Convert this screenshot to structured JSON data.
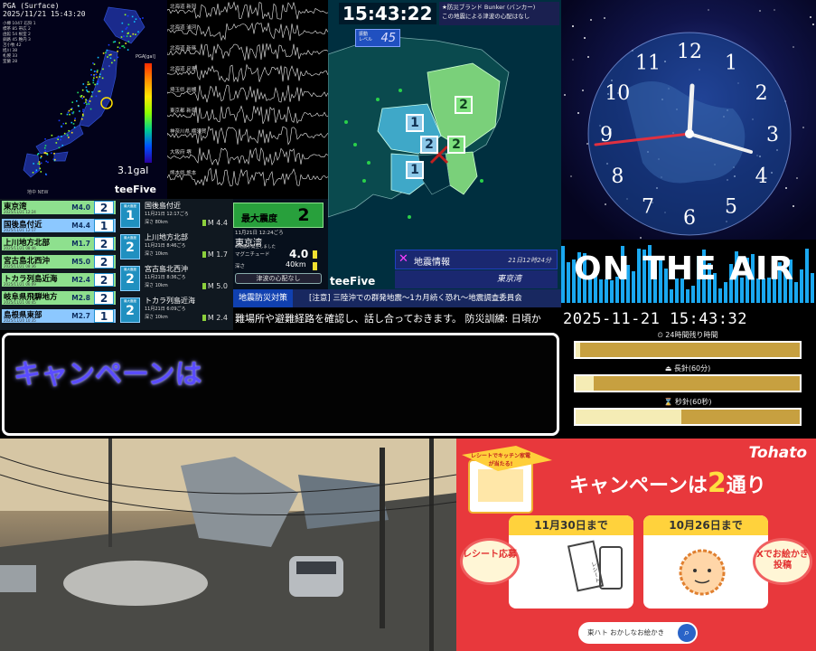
{
  "pga": {
    "header_title": "PGA (Surface)",
    "header_time": "2025/11/21 15:43:20",
    "legend_lines": [
      "小樽 1047 石狩 1",
      "標茶 85 帯広 2",
      "函館 54 根室 2",
      "釧路 45 稚内 3",
      "苫小牧 42",
      "旭川 38",
      "札幌 33",
      "室蘭 28"
    ],
    "scale_title": "PGA[gal]",
    "gal_value": "3.1gal",
    "gal_small": "3.1",
    "logo": "teeFive",
    "logo_small": "地中 NEW",
    "colors": {
      "land": "#1a2a8c"
    }
  },
  "seismo": {
    "stations": [
      "北海道 新冠",
      "北海道 浦河",
      "北海道 新篠",
      "北海道 足寄",
      "埼玉県 岩槻",
      "東京都 新宿",
      "神奈川県 横須賀",
      "大阪府 堺",
      "熊本県 熊本"
    ]
  },
  "quake_list": [
    {
      "name": "東京湾",
      "date": "2025/11/21 12:24",
      "mag": "M4.0",
      "intensity": "2",
      "bg": "#8ee08e",
      "fg": "#000"
    },
    {
      "name": "国後島付近",
      "date": "2025/11/21 12:17",
      "mag": "M4.4",
      "intensity": "1",
      "bg": "#8cc8ff",
      "fg": "#000"
    },
    {
      "name": "上川地方北部",
      "date": "2025/11/21 08:46",
      "mag": "M1.7",
      "intensity": "2",
      "bg": "#8ee08e",
      "fg": "#000"
    },
    {
      "name": "宮古島北西沖",
      "date": "2025/11/21 08:36",
      "mag": "M5.0",
      "intensity": "2",
      "bg": "#8ee08e",
      "fg": "#000"
    },
    {
      "name": "トカラ列島近海",
      "date": "2025/11/21 06:09",
      "mag": "M2.4",
      "intensity": "2",
      "bg": "#8ee08e",
      "fg": "#000"
    },
    {
      "name": "岐阜県飛騨地方",
      "date": "2025/11/21 00:45",
      "mag": "M2.8",
      "intensity": "2",
      "bg": "#8ee08e",
      "fg": "#000"
    },
    {
      "name": "島根県東部",
      "date": "2025/11/20 10:35",
      "mag": "M2.7",
      "intensity": "1",
      "bg": "#8cc8ff",
      "fg": "#000"
    }
  ],
  "quake_detail": {
    "box_label": "最大震度",
    "entries": [
      {
        "intensity": "1",
        "name": "国後島付近",
        "time": "11月21日 12:17ごろ",
        "depth": "深さ 80km",
        "mag": "M 4.4"
      },
      {
        "intensity": "2",
        "name": "上川地方北部",
        "time": "11月21日 8:46ごろ",
        "depth": "深さ 10km",
        "mag": "M 1.7"
      },
      {
        "intensity": "2",
        "name": "宮古島北西沖",
        "time": "11月21日 8:36ごろ",
        "depth": "深さ 10km",
        "mag": "M 5.0"
      },
      {
        "intensity": "2",
        "name": "トカラ列島近海",
        "time": "11月21日 6:09ごろ",
        "depth": "深さ 10km",
        "mag": "M 2.4"
      }
    ]
  },
  "max_box": {
    "label": "最大震度",
    "value": "2",
    "date": "11月21日 12:24ごろ",
    "location": "東京湾",
    "location_sub": "の地震が発生しました",
    "mag_label": "マグニチュード",
    "mag_value": "4.0",
    "depth_label": "深さ",
    "depth_value": "40km",
    "tsunami": "津波の心配なし"
  },
  "epicenter_map": {
    "clock": "15:43:22",
    "side_title_1": "★防災ブランド Bunker (バンカー)",
    "side_title_2": "この地震による津波の心配はなし",
    "level_label_1": "振動",
    "level_label_2": "レベル",
    "level_value": "45",
    "info_title": "地震情報",
    "info_mark": "✕",
    "info_date": "21日12時24分",
    "info_location": "東京湾",
    "logo": "teeFive",
    "intensity_labels": [
      "2",
      "1",
      "2",
      "2",
      "1"
    ]
  },
  "ticker": {
    "tag": "地震防災対策",
    "message": "[注意] 三陸沖での群発地震〜1カ月続く恐れ〜地震調査委員会",
    "scroll": "難場所や避難経路を確認し、話し合っておきます。 防災訓練: 日頃か"
  },
  "campaign_box": {
    "text": "キャンペーンは"
  },
  "analog_clock": {
    "numerals": [
      "12",
      "1",
      "2",
      "3",
      "4",
      "5",
      "6",
      "7",
      "8",
      "9",
      "10",
      "11"
    ]
  },
  "on_air": {
    "text": "ON THE AIR"
  },
  "datetime": {
    "value": "2025-11-21 15:43:32",
    "progress": [
      {
        "label": "⏲ 24時間残り時間",
        "fraction": 0.02
      },
      {
        "label": "⏏ 長針(60分)",
        "fraction": 0.08
      },
      {
        "label": "⌛ 秒針(60秒)",
        "fraction": 0.47
      }
    ]
  },
  "ad": {
    "brand": "Tohato",
    "head_a": "キャンペーンは",
    "head_b": "2",
    "head_c": "通り",
    "tag_small": "レシートでキッチン家電が当たる!",
    "card1_date": "11月30日まで",
    "card2_date": "10月26日まで",
    "badge1": "レシート応募",
    "badge2": "Xでお絵かき投稿",
    "receipt_label": "レシート",
    "search_text": "東ハト おかしなお絵かき",
    "colors": {
      "bg": "#e8383c",
      "yellow": "#ffd23c"
    }
  }
}
